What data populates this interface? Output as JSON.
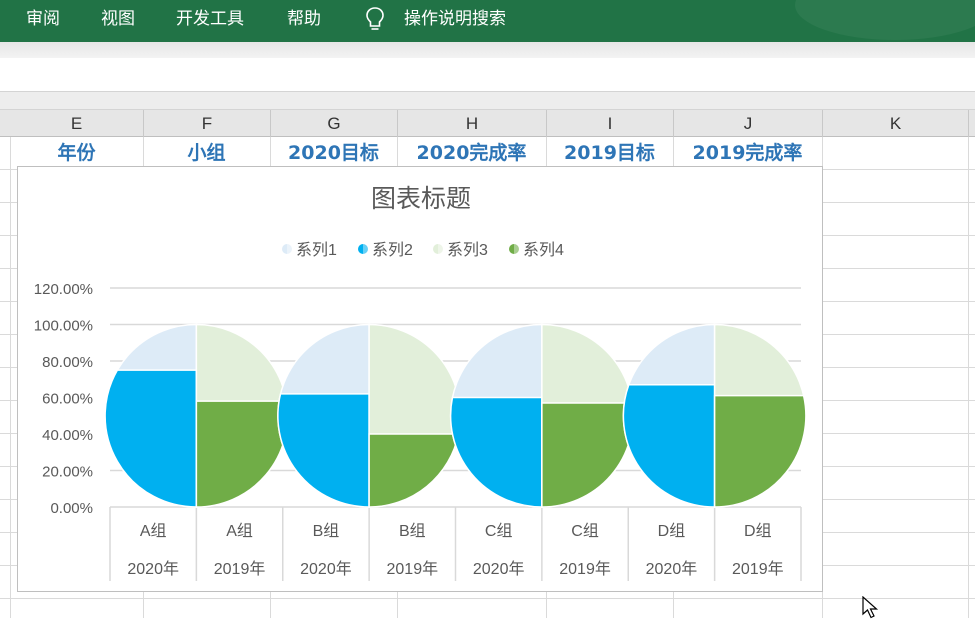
{
  "ribbon": {
    "tabs": [
      "审阅",
      "视图",
      "开发工具",
      "帮助"
    ],
    "tell_me": "操作说明搜索"
  },
  "columns": [
    "E",
    "F",
    "G",
    "H",
    "I",
    "J",
    "K"
  ],
  "header_row": [
    "年份",
    "小组",
    "2020目标",
    "2020完成率",
    "2019目标",
    "2019完成率"
  ],
  "colors": {
    "ribbon": "#217346",
    "header_text": "#2e75b6",
    "series1": "#ddebf7",
    "series2": "#00b0f0",
    "series3": "#e2efda",
    "series4": "#70ad47"
  },
  "chart_data": {
    "type": "pie",
    "title": "图表标题",
    "legend_position": "top",
    "series_names": [
      "系列1",
      "系列2",
      "系列3",
      "系列4"
    ],
    "y_axis": {
      "min": 0,
      "max": 1.2,
      "step": 0.2,
      "ticks": [
        "0.00%",
        "20.00%",
        "40.00%",
        "60.00%",
        "80.00%",
        "100.00%",
        "120.00%"
      ]
    },
    "categories": [
      {
        "group": "A组",
        "year": "2020年"
      },
      {
        "group": "A组",
        "year": "2019年"
      },
      {
        "group": "B组",
        "year": "2020年"
      },
      {
        "group": "B组",
        "year": "2019年"
      },
      {
        "group": "C组",
        "year": "2020年"
      },
      {
        "group": "C组",
        "year": "2019年"
      },
      {
        "group": "D组",
        "year": "2020年"
      },
      {
        "group": "D组",
        "year": "2019年"
      }
    ],
    "half_pies": [
      {
        "group": "A组",
        "year": "2020年",
        "side": "left",
        "series": "系列2",
        "value": 0.75,
        "background_series": "系列1"
      },
      {
        "group": "A组",
        "year": "2019年",
        "side": "right",
        "series": "系列4",
        "value": 0.58,
        "background_series": "系列3"
      },
      {
        "group": "B组",
        "year": "2020年",
        "side": "left",
        "series": "系列2",
        "value": 0.62,
        "background_series": "系列1"
      },
      {
        "group": "B组",
        "year": "2019年",
        "side": "right",
        "series": "系列4",
        "value": 0.4,
        "background_series": "系列3"
      },
      {
        "group": "C组",
        "year": "2020年",
        "side": "left",
        "series": "系列2",
        "value": 0.6,
        "background_series": "系列1"
      },
      {
        "group": "C组",
        "year": "2019年",
        "side": "right",
        "series": "系列4",
        "value": 0.57,
        "background_series": "系列3"
      },
      {
        "group": "D组",
        "year": "2020年",
        "side": "left",
        "series": "系列2",
        "value": 0.67,
        "background_series": "系列1"
      },
      {
        "group": "D组",
        "year": "2019年",
        "side": "right",
        "series": "系列4",
        "value": 0.61,
        "background_series": "系列3"
      }
    ]
  }
}
